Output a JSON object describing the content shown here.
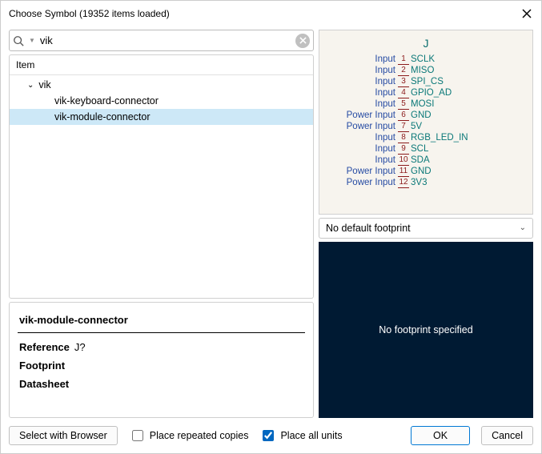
{
  "window": {
    "title": "Choose Symbol (19352 items loaded)"
  },
  "search": {
    "value": "vik"
  },
  "tree": {
    "header": "Item",
    "group": "vik",
    "items": [
      "vik-keyboard-connector",
      "vik-module-connector"
    ],
    "selected": "vik-module-connector"
  },
  "details": {
    "name": "vik-module-connector",
    "ref_label": "Reference",
    "ref_value": "J?",
    "fp_label": "Footprint",
    "ds_label": "Datasheet"
  },
  "symbol": {
    "refdes": "J",
    "pins": [
      {
        "n": "1",
        "type": "Input",
        "name": "SCLK"
      },
      {
        "n": "2",
        "type": "Input",
        "name": "MISO"
      },
      {
        "n": "3",
        "type": "Input",
        "name": "SPI_CS"
      },
      {
        "n": "4",
        "type": "Input",
        "name": "GPIO_AD"
      },
      {
        "n": "5",
        "type": "Input",
        "name": "MOSI"
      },
      {
        "n": "6",
        "type": "Power Input",
        "name": "GND"
      },
      {
        "n": "7",
        "type": "Power Input",
        "name": "5V"
      },
      {
        "n": "8",
        "type": "Input",
        "name": "RGB_LED_IN"
      },
      {
        "n": "9",
        "type": "Input",
        "name": "SCL"
      },
      {
        "n": "10",
        "type": "Input",
        "name": "SDA"
      },
      {
        "n": "11",
        "type": "Power Input",
        "name": "GND"
      },
      {
        "n": "12",
        "type": "Power Input",
        "name": "3V3"
      }
    ]
  },
  "footprint": {
    "select_label": "No default footprint",
    "preview_text": "No footprint specified"
  },
  "buttons": {
    "browser": "Select with Browser",
    "repeated": "Place repeated copies",
    "all_units": "Place all units",
    "ok": "OK",
    "cancel": "Cancel"
  }
}
